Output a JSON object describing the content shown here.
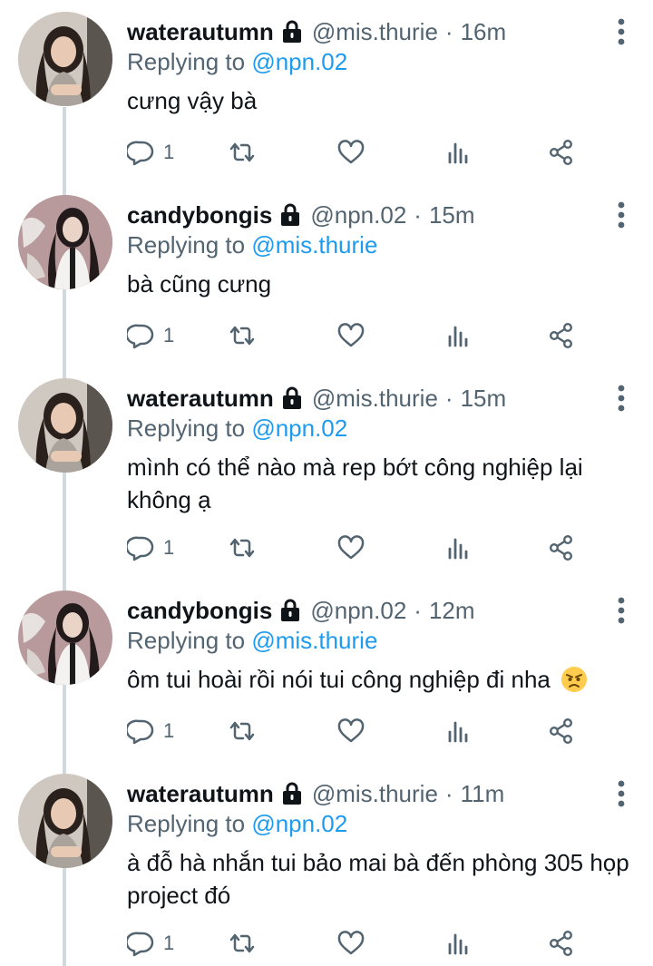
{
  "tweets": [
    {
      "name": "waterautumn",
      "handle": "@mis.thurie",
      "separator": "·",
      "time": "16m",
      "replying_prefix": "Replying to",
      "replying_to": "@npn.02",
      "text": "cưng vậy bà",
      "reply_count": "1",
      "avatar_icon": "avatar-waterautumn",
      "protected_icon": "lock-icon"
    },
    {
      "name": "candybongis",
      "handle": "@npn.02",
      "separator": "·",
      "time": "15m",
      "replying_prefix": "Replying to",
      "replying_to": "@mis.thurie",
      "text": "bà cũng cưng",
      "reply_count": "1",
      "avatar_icon": "avatar-candybongis",
      "protected_icon": "lock-icon"
    },
    {
      "name": "waterautumn",
      "handle": "@mis.thurie",
      "separator": "·",
      "time": "15m",
      "replying_prefix": "Replying to",
      "replying_to": "@npn.02",
      "text": "mình có thể nào mà rep bớt công nghiệp lại không ạ",
      "reply_count": "1",
      "avatar_icon": "avatar-waterautumn",
      "protected_icon": "lock-icon"
    },
    {
      "name": "candybongis",
      "handle": "@npn.02",
      "separator": "·",
      "time": "12m",
      "replying_prefix": "Replying to",
      "replying_to": "@mis.thurie",
      "text": "ôm tui hoài rồi nói tui công nghiệp đi nha",
      "emoji": "angry-face-emoji",
      "reply_count": "1",
      "avatar_icon": "avatar-candybongis",
      "protected_icon": "lock-icon"
    },
    {
      "name": "waterautumn",
      "handle": "@mis.thurie",
      "separator": "·",
      "time": "11m",
      "replying_prefix": "Replying to",
      "replying_to": "@npn.02",
      "text": "à đỗ hà nhắn tui bảo mai bà đến phòng 305 họp project đó",
      "reply_count": "1",
      "avatar_icon": "avatar-waterautumn",
      "protected_icon": "lock-icon"
    }
  ],
  "action_icons": [
    "reply-icon",
    "retweet-icon",
    "like-icon",
    "views-icon",
    "share-icon"
  ],
  "colors": {
    "text": "#0f1419",
    "secondary": "#536471",
    "accent": "#1d9bf0",
    "thread_line": "#cfd9de"
  }
}
